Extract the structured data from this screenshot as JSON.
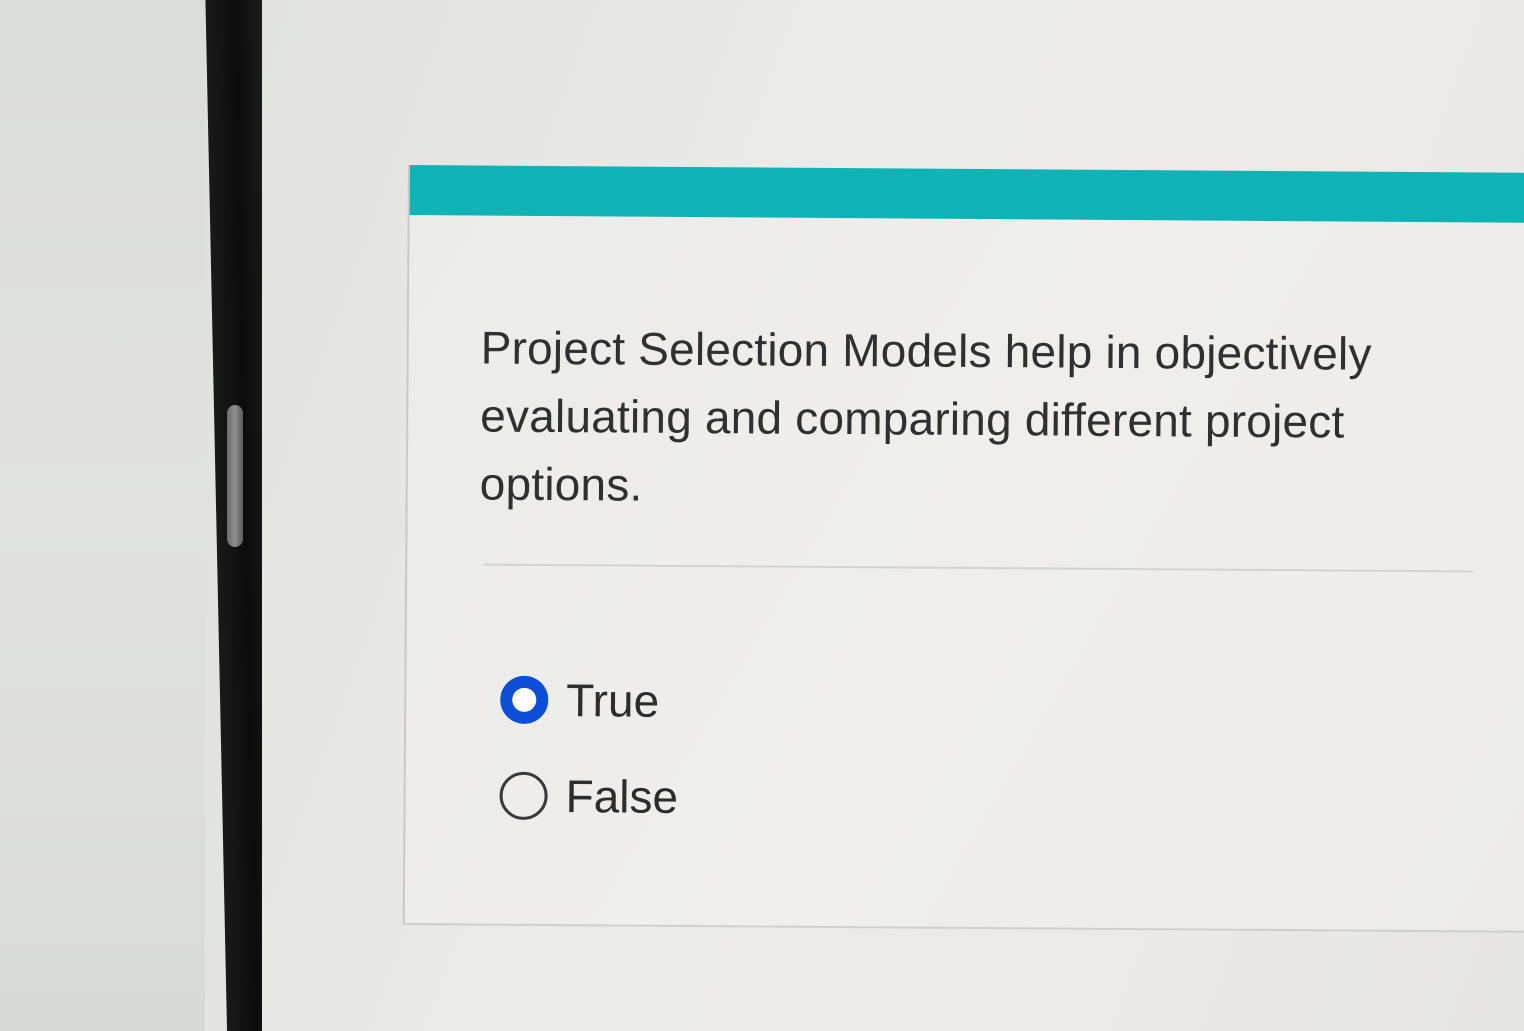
{
  "question": {
    "text": "Project Selection Models help in objectively evaluating and comparing different project options."
  },
  "answer_options": [
    {
      "label": "True",
      "selected": true
    },
    {
      "label": "False",
      "selected": false
    }
  ],
  "colors": {
    "accent_bar": "#0fb3b6",
    "radio_selected": "#0b4fd6",
    "text": "#2f3030"
  }
}
